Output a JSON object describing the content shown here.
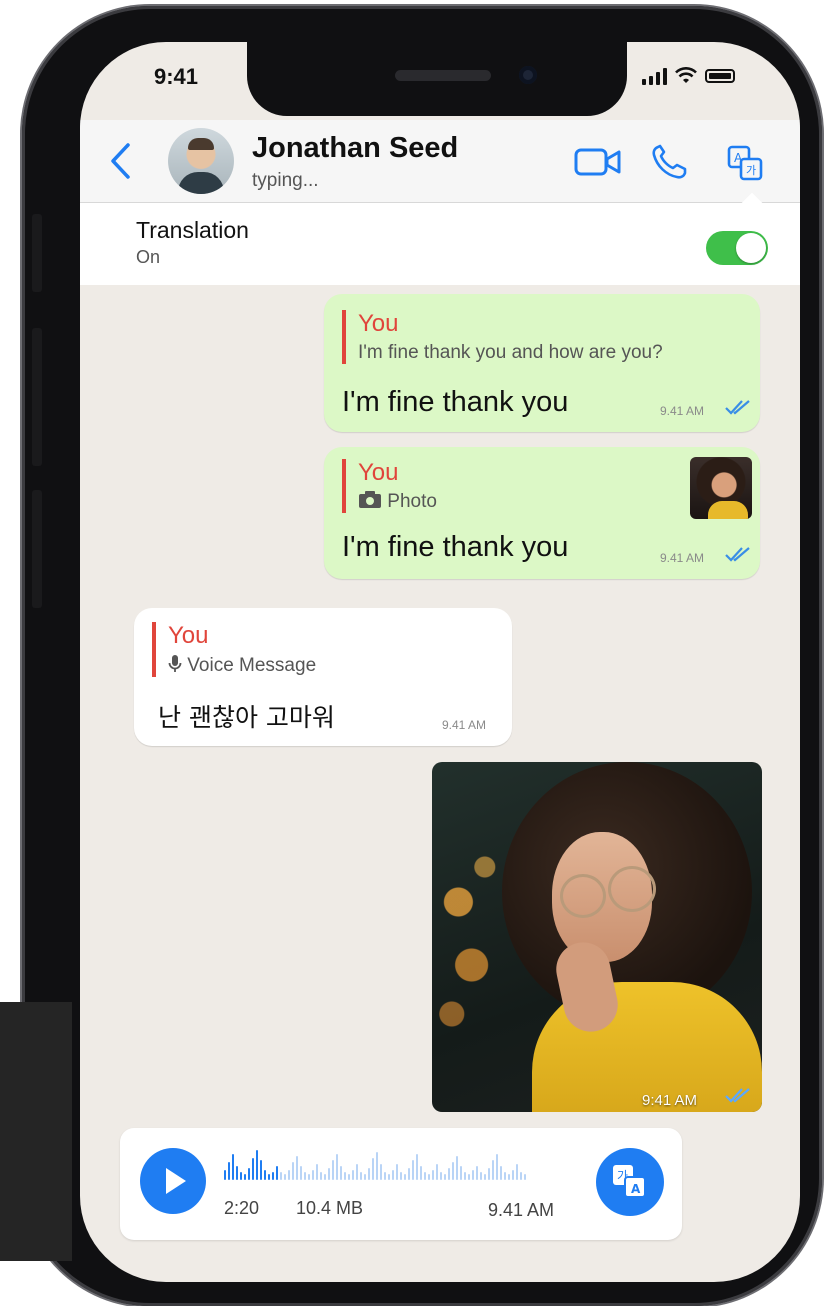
{
  "status_bar": {
    "time": "9:41"
  },
  "header": {
    "contact_name": "Jonathan Seed",
    "contact_status": "typing...",
    "icons": [
      "back-chevron-icon",
      "video-call-icon",
      "phone-call-icon",
      "translate-icon"
    ]
  },
  "translation": {
    "title": "Translation",
    "state": "On",
    "enabled": true
  },
  "messages": [
    {
      "sender": "You",
      "reply_text": "I'm fine thank you and how are you?",
      "text": "I'm fine thank you",
      "time": "9.41 AM"
    },
    {
      "sender": "You",
      "reply_text": "Photo",
      "text": "I'm fine thank you",
      "time": "9.41 AM"
    },
    {
      "sender": "You",
      "reply_text": "Voice Message",
      "text": "난 괜찮아 고마워",
      "time": "9.41 AM"
    },
    {
      "type": "photo",
      "time": "9:41 AM"
    }
  ],
  "voice_message": {
    "duration": "2:20",
    "size": "10.4 MB",
    "time": "9.41 AM",
    "progress": 0.18
  },
  "colors": {
    "accent": "#1f7df2",
    "outgoing_bubble": "#dcf8c6",
    "reply_bar": "#e0453b",
    "toggle_on": "#3fbf4a"
  }
}
